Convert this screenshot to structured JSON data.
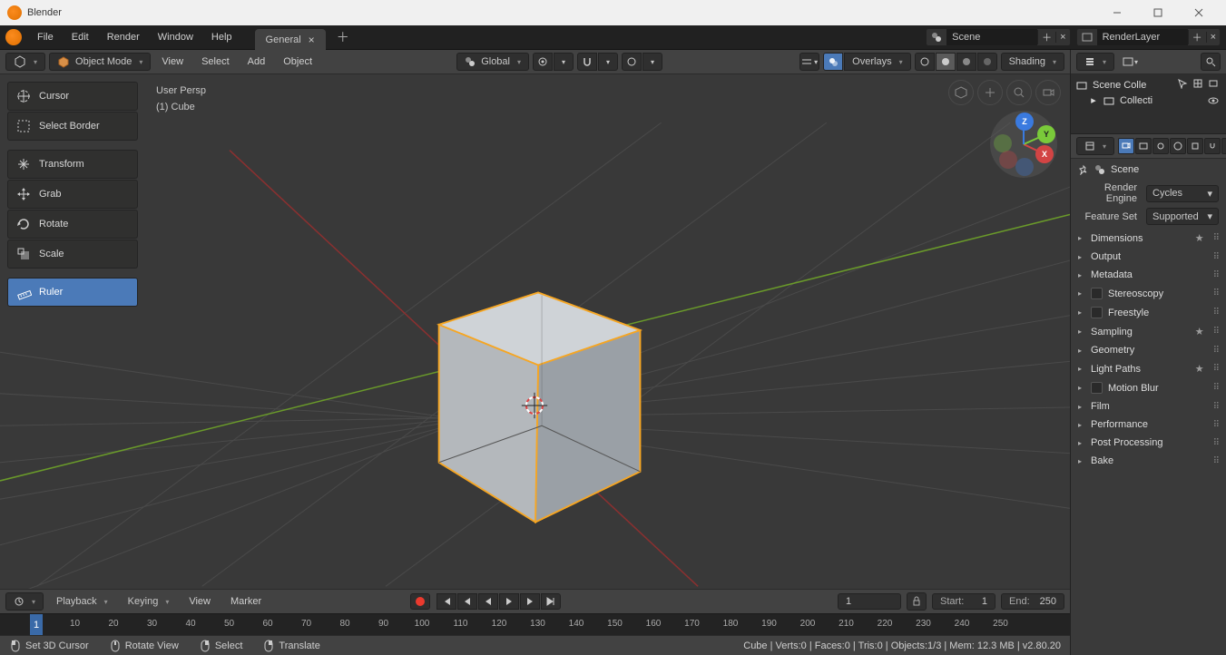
{
  "window": {
    "title": "Blender"
  },
  "topmenu": {
    "file": "File",
    "edit": "Edit",
    "render": "Render",
    "window": "Window",
    "help": "Help"
  },
  "workspace": {
    "tab": "General"
  },
  "scene_field": {
    "value": "Scene"
  },
  "layer_field": {
    "value": "RenderLayer"
  },
  "v3d_header": {
    "mode": "Object Mode",
    "view": "View",
    "select": "Select",
    "add": "Add",
    "object": "Object",
    "orientation": "Global",
    "overlays": "Overlays",
    "shading": "Shading"
  },
  "toolbar": {
    "cursor": "Cursor",
    "select_border": "Select Border",
    "transform": "Transform",
    "grab": "Grab",
    "rotate": "Rotate",
    "scale": "Scale",
    "ruler": "Ruler"
  },
  "view_info": {
    "persp": "User Persp",
    "object": "(1) Cube"
  },
  "timeline": {
    "playback": "Playback",
    "keying": "Keying",
    "view": "View",
    "marker": "Marker",
    "current": "1",
    "start_label": "Start:",
    "start": "1",
    "end_label": "End:",
    "end": "250",
    "ticks": [
      "10",
      "20",
      "30",
      "40",
      "50",
      "60",
      "70",
      "80",
      "90",
      "100",
      "110",
      "120",
      "130",
      "140",
      "150",
      "160",
      "170",
      "180",
      "190",
      "200",
      "210",
      "220",
      "230",
      "240",
      "250"
    ]
  },
  "statusbar": {
    "set3d": "Set 3D Cursor",
    "rotate_view": "Rotate View",
    "select": "Select",
    "translate": "Translate",
    "stats": "Cube | Verts:0 | Faces:0 | Tris:0 | Objects:1/3 | Mem: 12.3 MB | v2.80.20"
  },
  "outliner": {
    "root": "Scene Colle",
    "child": "Collecti"
  },
  "props": {
    "crumb": "Scene",
    "render_engine_label": "Render Engine",
    "render_engine": "Cycles",
    "feature_set_label": "Feature Set",
    "feature_set": "Supported",
    "panels": {
      "dimensions": "Dimensions",
      "output": "Output",
      "metadata": "Metadata",
      "stereoscopy": "Stereoscopy",
      "freestyle": "Freestyle",
      "sampling": "Sampling",
      "geometry": "Geometry",
      "light_paths": "Light Paths",
      "motion_blur": "Motion Blur",
      "film": "Film",
      "performance": "Performance",
      "post_processing": "Post Processing",
      "bake": "Bake"
    }
  }
}
